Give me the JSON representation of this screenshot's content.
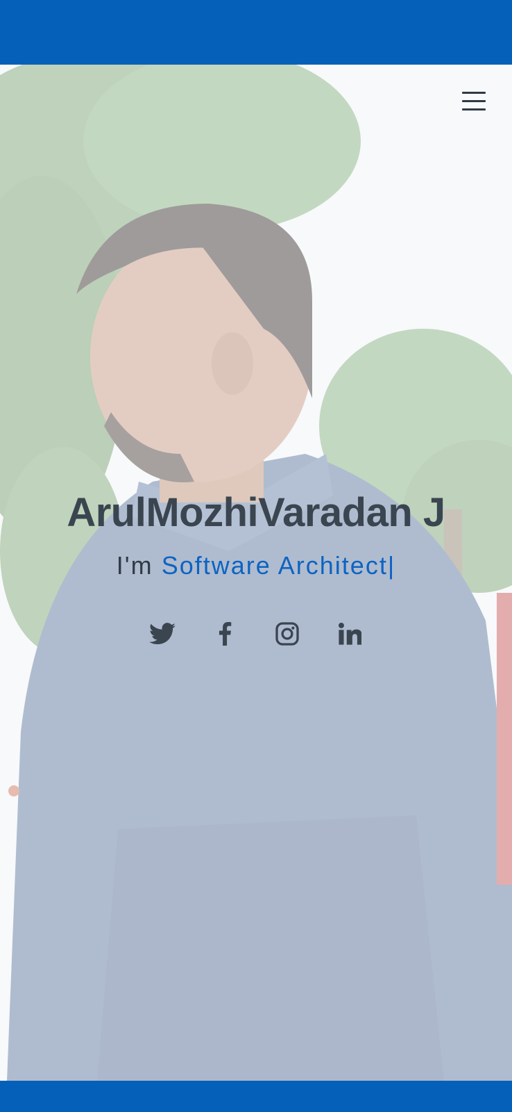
{
  "hero": {
    "name": "ArulMozhiVaradan J",
    "subtitle_prefix": "I'm",
    "subtitle_role": "Software Architect",
    "cursor": "|"
  },
  "social": [
    {
      "icon": "twitter-icon"
    },
    {
      "icon": "facebook-icon"
    },
    {
      "icon": "instagram-icon"
    },
    {
      "icon": "linkedin-icon"
    }
  ],
  "menu": {
    "icon": "hamburger-menu-icon"
  },
  "colors": {
    "brand_blue": "#0560b9",
    "accent_text": "#0e63c2",
    "dark_text": "#3a4550"
  }
}
